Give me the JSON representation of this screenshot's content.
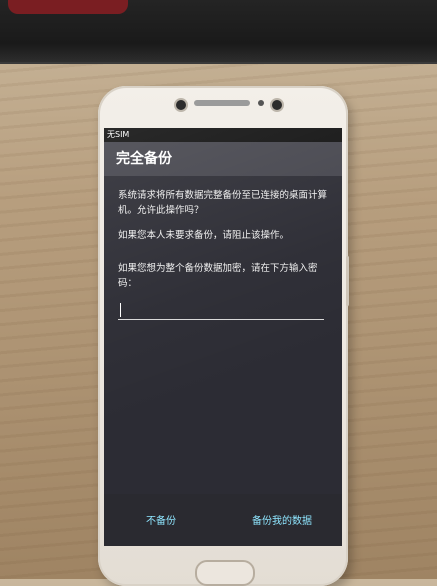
{
  "status_bar": {
    "text": "无SIM"
  },
  "dialog": {
    "title": "完全备份",
    "message1": "系统请求将所有数据完整备份至已连接的桌面计算机。允许此操作吗？",
    "message2": "如果您本人未要求备份，请阻止该操作。",
    "encrypt_prompt": "如果您想为整个备份数据加密，请在下方输入密码：",
    "password_value": "",
    "buttons": {
      "deny": "不备份",
      "backup": "备份我的数据"
    }
  },
  "colors": {
    "dialog_bg": "#2c2c34",
    "title_bg": "#45454d",
    "button_text": "#8fe6ff"
  }
}
